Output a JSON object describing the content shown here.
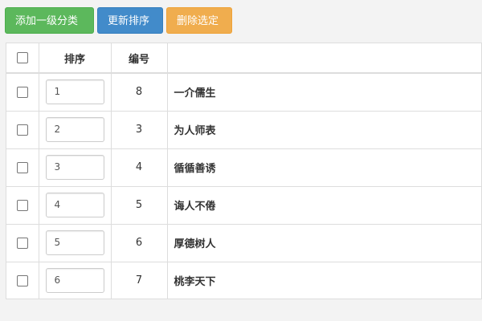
{
  "toolbar": {
    "add_label": "添加一级分类",
    "update_label": "更新排序",
    "delete_label": "删除选定"
  },
  "table": {
    "columns": [
      "",
      "排序",
      "编号",
      ""
    ],
    "rows": [
      {
        "sort": "1",
        "id": "8",
        "name": "一介儒生"
      },
      {
        "sort": "2",
        "id": "3",
        "name": "为人师表"
      },
      {
        "sort": "3",
        "id": "4",
        "name": "循循善诱"
      },
      {
        "sort": "4",
        "id": "5",
        "name": "诲人不倦"
      },
      {
        "sort": "5",
        "id": "6",
        "name": "厚德树人"
      },
      {
        "sort": "6",
        "id": "7",
        "name": "桃李天下"
      }
    ]
  },
  "colors": {
    "green": "#5cb85c",
    "blue": "#428bca",
    "orange": "#f0ad4e"
  }
}
